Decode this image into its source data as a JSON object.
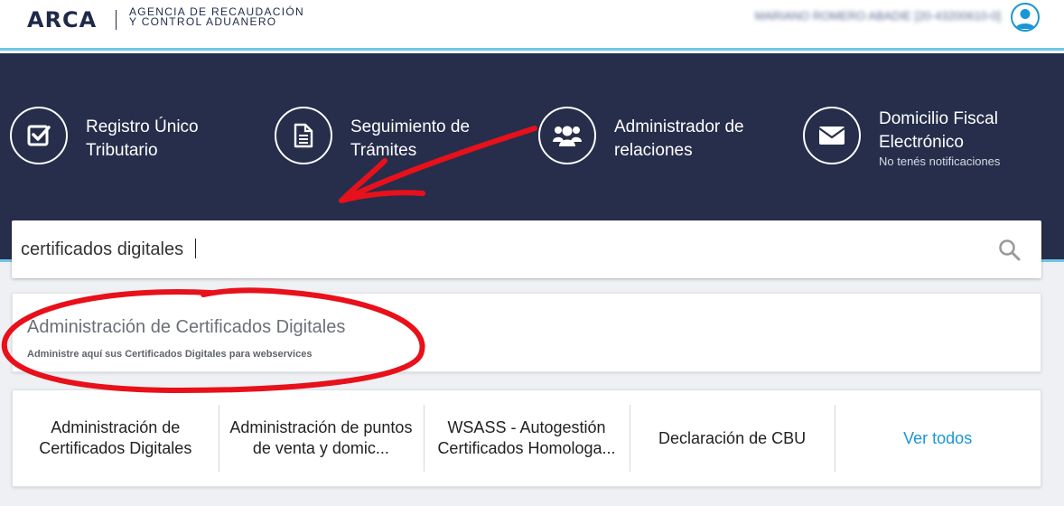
{
  "header": {
    "logo": "ARCA",
    "agency_line1": "AGENCIA DE RECAUDACIÓN",
    "agency_line2": "Y CONTROL ADUANERO",
    "user_blurred": "MARIANO ROMERO ABADIE [20-43200610-0]"
  },
  "services": [
    {
      "title_line1": "Registro Único",
      "title_line2": "Tributario",
      "subtitle": "",
      "icon": "checkbox-icon"
    },
    {
      "title_line1": "Seguimiento de",
      "title_line2": "Trámites",
      "subtitle": "",
      "icon": "document-icon"
    },
    {
      "title_line1": "Administrador de",
      "title_line2": "relaciones",
      "subtitle": "",
      "icon": "people-icon"
    },
    {
      "title_line1": "Domicilio Fiscal",
      "title_line2": "Electrónico",
      "subtitle": "No tenés notificaciones",
      "icon": "envelope-icon"
    }
  ],
  "search": {
    "value": "certificados digitales",
    "icon": "search-icon"
  },
  "suggestion": {
    "title": "Administración de Certificados Digitales",
    "description": "Administre aquí sus Certificados Digitales para webservices"
  },
  "quick_links": [
    "Administración de Certificados Digitales",
    "Administración de puntos de venta y domic...",
    "WSASS - Autogestión Certificados Homologa...",
    "Declaración de CBU",
    "Ver todos"
  ],
  "colors": {
    "band": "#262e4b",
    "accent": "#6ec6e6",
    "link": "#1a96d4",
    "annotation": "#e8101a"
  }
}
